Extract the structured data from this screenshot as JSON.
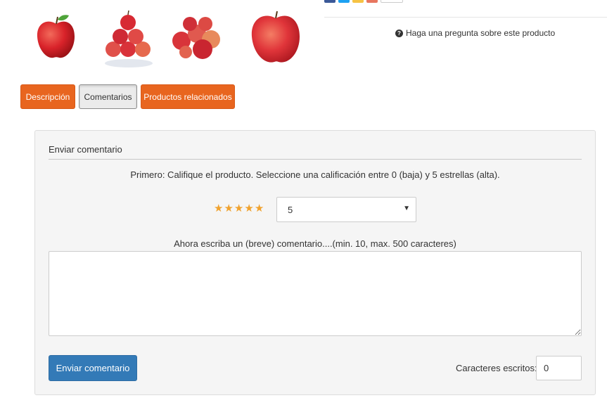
{
  "gallery": {
    "thumbnails": [
      {
        "icon": "single-apple-image"
      },
      {
        "icon": "apple-pyramid-image"
      },
      {
        "icon": "apple-pile-image"
      },
      {
        "icon": "large-apple-image"
      }
    ]
  },
  "share": {
    "icons": [
      "facebook-icon",
      "twitter-icon",
      "rss-icon",
      "google-plus-icon",
      "more-share-icon"
    ]
  },
  "ask_question": {
    "icon": "question-circle-icon",
    "label": "Haga una pregunta sobre este producto"
  },
  "tabs": [
    {
      "label": "Descripción",
      "active": false
    },
    {
      "label": "Comentarios",
      "active": true
    },
    {
      "label": "Productos relacionados",
      "active": false
    }
  ],
  "review_form": {
    "legend": "Enviar comentario",
    "instruction": "Primero: Califique el producto. Seleccione una calificación entre 0 (baja) y 5 estrellas (alta).",
    "rating": {
      "stars": 5,
      "star_icon": "star-icon",
      "selected_value": "5"
    },
    "comment_label": "Ahora escriba un (breve) comentario....(min. 10, max. 500 caracteres)",
    "comment_value": "",
    "submit_label": "Enviar comentario",
    "chars_label": "Caracteres escritos:",
    "chars_value": "0"
  },
  "colors": {
    "tab_orange": "#e8651f",
    "submit_blue": "#337ab7",
    "star_gold": "#f0a22e",
    "apple_red": "#d9232a"
  }
}
